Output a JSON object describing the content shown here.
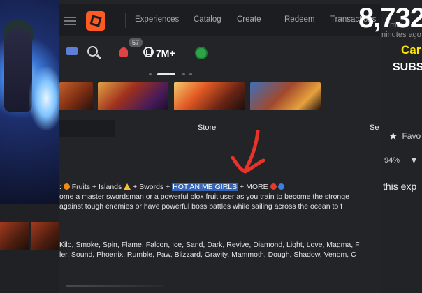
{
  "nav": {
    "items": [
      "Experiences",
      "Catalog",
      "Create",
      "Redeem",
      "Transactions"
    ]
  },
  "toolbar": {
    "notifications_count": "57",
    "robux_amount": "7M+"
  },
  "tabs": {
    "store": "Store",
    "server_partial": "Se"
  },
  "description": {
    "line1_prefix": ": ",
    "fruits": " Fruits + Islands ",
    "swords": " + Swords + ",
    "highlight": "HOT ANIME GIRLS",
    "more": " + MORE",
    "line2": "ome a master swordsman or a powerful blox fruit user as you train to become the stronge",
    "line3": " against tough enemies or have powerful boss battles while sailing across the ocean to f",
    "line4": "Kilo, Smoke, Spin, Flame, Falcon, Ice, Sand, Dark, Revive, Diamond, Light, Love, Magma, F",
    "line5": "ler, Sound, Phoenix, Rumble, Paw, Blizzard, Gravity, Mammoth, Dough, Shadow, Venom, C"
  },
  "overlay": {
    "count": "8,732",
    "time": "7min",
    "ago": "ninutes ago",
    "yellow_text": "Car",
    "white_text": "SUBS",
    "favorite": "Favo",
    "rating": "94%",
    "this_exp": "this exp"
  },
  "colors": {
    "accent_orange": "#ff5a24",
    "highlight_blue": "#3464b8",
    "annotation_red": "#e8332a",
    "overlay_yellow": "#ffe600"
  }
}
